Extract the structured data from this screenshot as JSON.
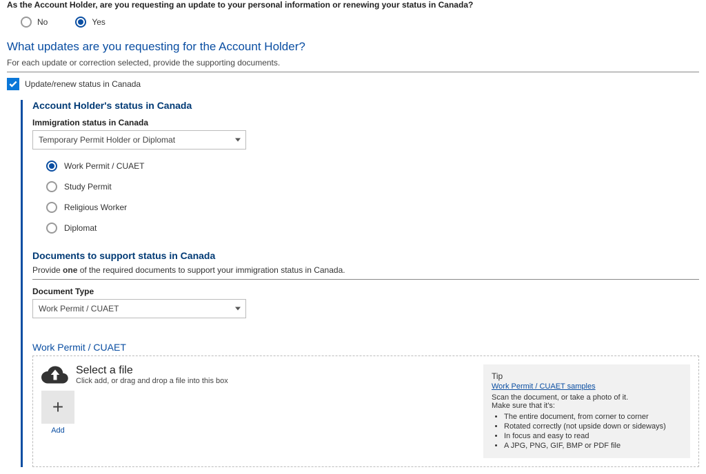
{
  "q1": "As the Account Holder, are you requesting an update to your personal information or renewing your status in Canada?",
  "q1_options": {
    "no": "No",
    "yes": "Yes"
  },
  "section": {
    "title": "What updates are you requesting for the Account Holder?",
    "subtitle": "For each update or correction selected, provide the supporting documents."
  },
  "checkbox_label": "Update/renew status in Canada",
  "status": {
    "heading": "Account Holder's status in Canada",
    "field_label": "Immigration status in Canada",
    "selected": "Temporary Permit Holder or Diplomat",
    "options": {
      "work": "Work Permit / CUAET",
      "study": "Study Permit",
      "religious": "Religious Worker",
      "diplomat": "Diplomat"
    }
  },
  "docs": {
    "heading": "Documents to support status in Canada",
    "subtitle_pre": "Provide ",
    "subtitle_bold": "one",
    "subtitle_post": " of the required documents to support your immigration status in Canada.",
    "field_label": "Document Type",
    "selected": "Work Permit / CUAET"
  },
  "upload": {
    "title": "Work Permit / CUAET",
    "select_file": "Select a file",
    "select_sub": "Click add, or drag and drop a file into this box",
    "add_label": "Add"
  },
  "tip": {
    "title": "Tip",
    "link": "Work Permit / CUAET samples",
    "line1": "Scan the document, or take a photo of it.",
    "line2": "Make sure that it's:",
    "items": {
      "a": "The entire document, from corner to corner",
      "b": "Rotated correctly (not upside down or sideways)",
      "c": "In focus and easy to read",
      "d": "A JPG, PNG, GIF, BMP or PDF file"
    }
  }
}
